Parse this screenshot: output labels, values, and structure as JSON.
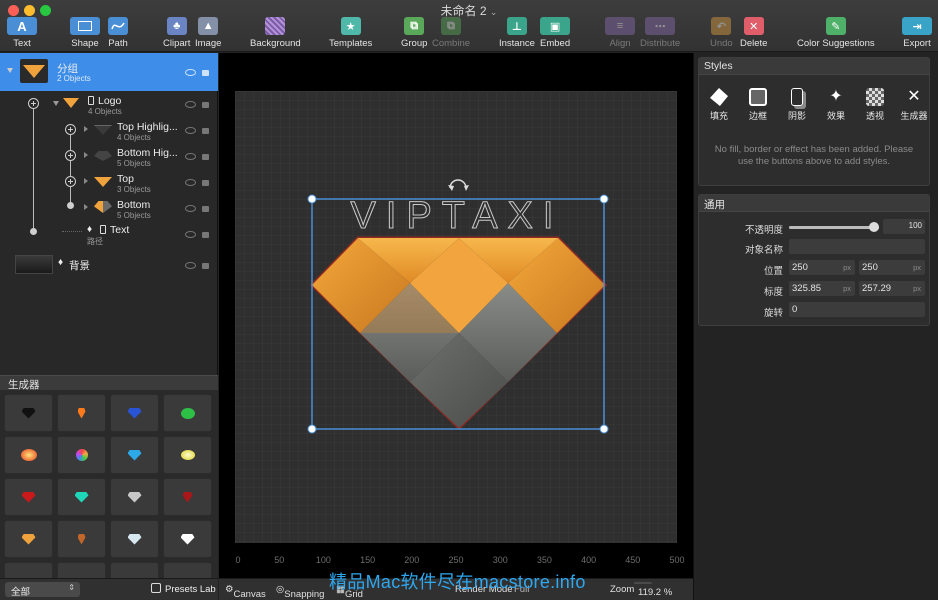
{
  "window": {
    "title": "未命名 2",
    "title_chevron": "⌄"
  },
  "colors": {
    "close": "#fe5f57",
    "minimize": "#febc2e",
    "maximize": "#28c840",
    "selection": "#3e8ee9",
    "accent": "#f0a23c"
  },
  "toolbar": {
    "text": "Text",
    "shape": "Shape",
    "path": "Path",
    "clipart": "Clipart",
    "image": "Image",
    "background": "Background",
    "templates": "Templates",
    "group": "Group",
    "combine": "Combine",
    "instance": "Instance",
    "embed": "Embed",
    "align": "Align",
    "distribute": "Distribute",
    "undo": "Undo",
    "delete": "Delete",
    "color_suggestions": "Color Suggestions",
    "export": "Export",
    "text_icon_glyph": "A"
  },
  "layers": [
    {
      "name": "分组",
      "sub": "2 Objects"
    },
    {
      "name": "Logo",
      "sub": "4 Objects"
    },
    {
      "name": "Top Highlig...",
      "sub": "4 Objects"
    },
    {
      "name": "Bottom Hig...",
      "sub": "5 Objects"
    },
    {
      "name": "Top",
      "sub": "3 Objects"
    },
    {
      "name": "Bottom",
      "sub": "5 Objects"
    },
    {
      "name": "Text",
      "sub": "路径"
    },
    {
      "name": "背景",
      "sub": ""
    }
  ],
  "generator": {
    "title": "生成器",
    "filter": "全部",
    "presets_lab": "Presets Lab"
  },
  "canvas": {
    "logo_text": "VIPTAXI",
    "ruler_ticks": [
      "0",
      "50",
      "100",
      "150",
      "200",
      "250",
      "300",
      "350",
      "400",
      "450",
      "500"
    ],
    "footer": {
      "canvas": "Canvas",
      "snapping": "Snapping",
      "grid": "Grid",
      "render_mode_label": "Render Mode",
      "render_mode_value": "Full",
      "zoom_label": "Zoom",
      "zoom_value": "119.2 %"
    }
  },
  "styles_panel": {
    "title": "Styles",
    "buttons": [
      "填充",
      "边框",
      "阴影",
      "效果",
      "透视",
      "生成器"
    ],
    "empty_message": "No fill, border or effect has been added. Please use the buttons above to add styles."
  },
  "general_panel": {
    "title": "通用",
    "opacity_label": "不透明度",
    "opacity_value": "100",
    "opacity_fraction": 1.0,
    "name_label": "对象名称",
    "position_label": "位置",
    "pos_x": "250",
    "pos_y": "250",
    "size_label": "标度",
    "width": "325.85",
    "height": "257.29",
    "rotation_label": "旋转",
    "rotation": "0",
    "unit": "px"
  },
  "watermark": "精品Mac软件尽在macstore.info"
}
